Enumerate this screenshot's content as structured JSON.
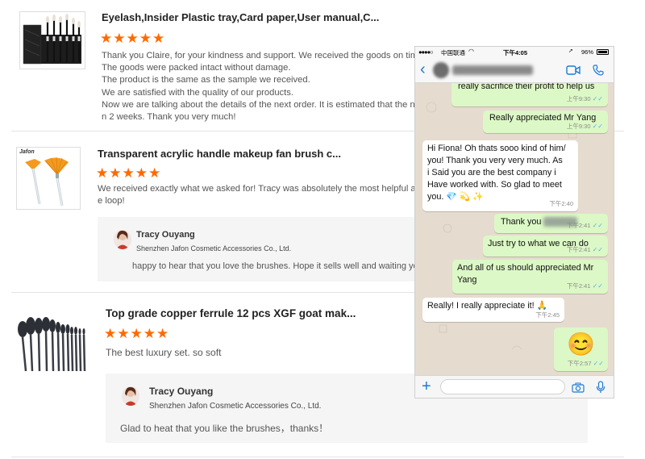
{
  "reviews": [
    {
      "title": "Eyelash,Insider Plastic tray,Card paper,User manual,C...",
      "stars": "★★★★★",
      "lines": [
        "Thank you Claire, for your kindness and support. We received the goods on tim",
        "The goods were packed intact without damage.",
        "The product is the same as the sample we received.",
        "We are satisfied with the quality of our products.",
        "Now we are talking about the details of the next order. It is estimated that the n",
        "n 2 weeks. Thank you very much!"
      ]
    },
    {
      "title": "Transparent acrylic handle makeup fan brush c...",
      "stars": "★★★★★",
      "lines": [
        "We received exactly what we asked for! Tracy was absolutely the most helpful and s",
        "e loop!"
      ],
      "reply": {
        "name": "Tracy Ouyang",
        "company": "Shenzhen Jafon Cosmetic Accessories Co., Ltd.",
        "text": "happy to hear that you love the brushes. Hope it sells well and waiting your"
      },
      "thumb_label": "Jafon"
    },
    {
      "title": "Top grade copper ferrule 12 pcs XGF goat mak...",
      "stars": "★★★★★",
      "lines": [
        "The best luxury set. so soft"
      ],
      "reply": {
        "name": "Tracy Ouyang",
        "company": "Shenzhen Jafon Cosmetic Accessories Co., Ltd.",
        "text": "Glad to heat that you like the brushes，thanks！"
      }
    }
  ],
  "phone": {
    "carrier": "中国联通",
    "time": "下午4:05",
    "battery": "96%",
    "messages": [
      {
        "dir": "out",
        "text": "really sacrifice their profit to help us",
        "time": "上午9:30"
      },
      {
        "dir": "out",
        "text": "Really appreciated Mr Yang",
        "time": "上午9:30"
      },
      {
        "dir": "in",
        "lines": [
          "Hi Fiona! Oh thats sooo kind of him/",
          "you! Thank you very very much. As",
          "i Said you are the best company i",
          "Have worked with. So glad to meet",
          "you. 💎 💫 ✨"
        ],
        "time": "下午2:40"
      },
      {
        "dir": "out",
        "text": "Thank you",
        "time": "下午2:41"
      },
      {
        "dir": "out",
        "text": "Just try to what we can do",
        "time": "下午2:41"
      },
      {
        "dir": "out",
        "lines": [
          "And all of us should appreciated Mr",
          "Yang"
        ],
        "time": "下午2:41"
      },
      {
        "dir": "in",
        "text": "Really! I really appreciate it! 🙏",
        "time": "下午2:45"
      },
      {
        "dir": "out",
        "text": "😊",
        "time": "下午2:57"
      }
    ]
  },
  "icons": {
    "back": "back-chevron-icon",
    "video": "video-call-icon",
    "call": "phone-call-icon",
    "add": "plus-icon",
    "camera": "camera-icon",
    "mic": "microphone-icon",
    "star": "star-icon",
    "emoji": "smiley-emoji"
  },
  "colors": {
    "star": "#ff6a00",
    "outgoing_bubble": "#dcf8c6",
    "chat_bg": "#e5dccf",
    "wa_blue": "#1e7bd6",
    "read_ticks": "#4fb3e8"
  }
}
